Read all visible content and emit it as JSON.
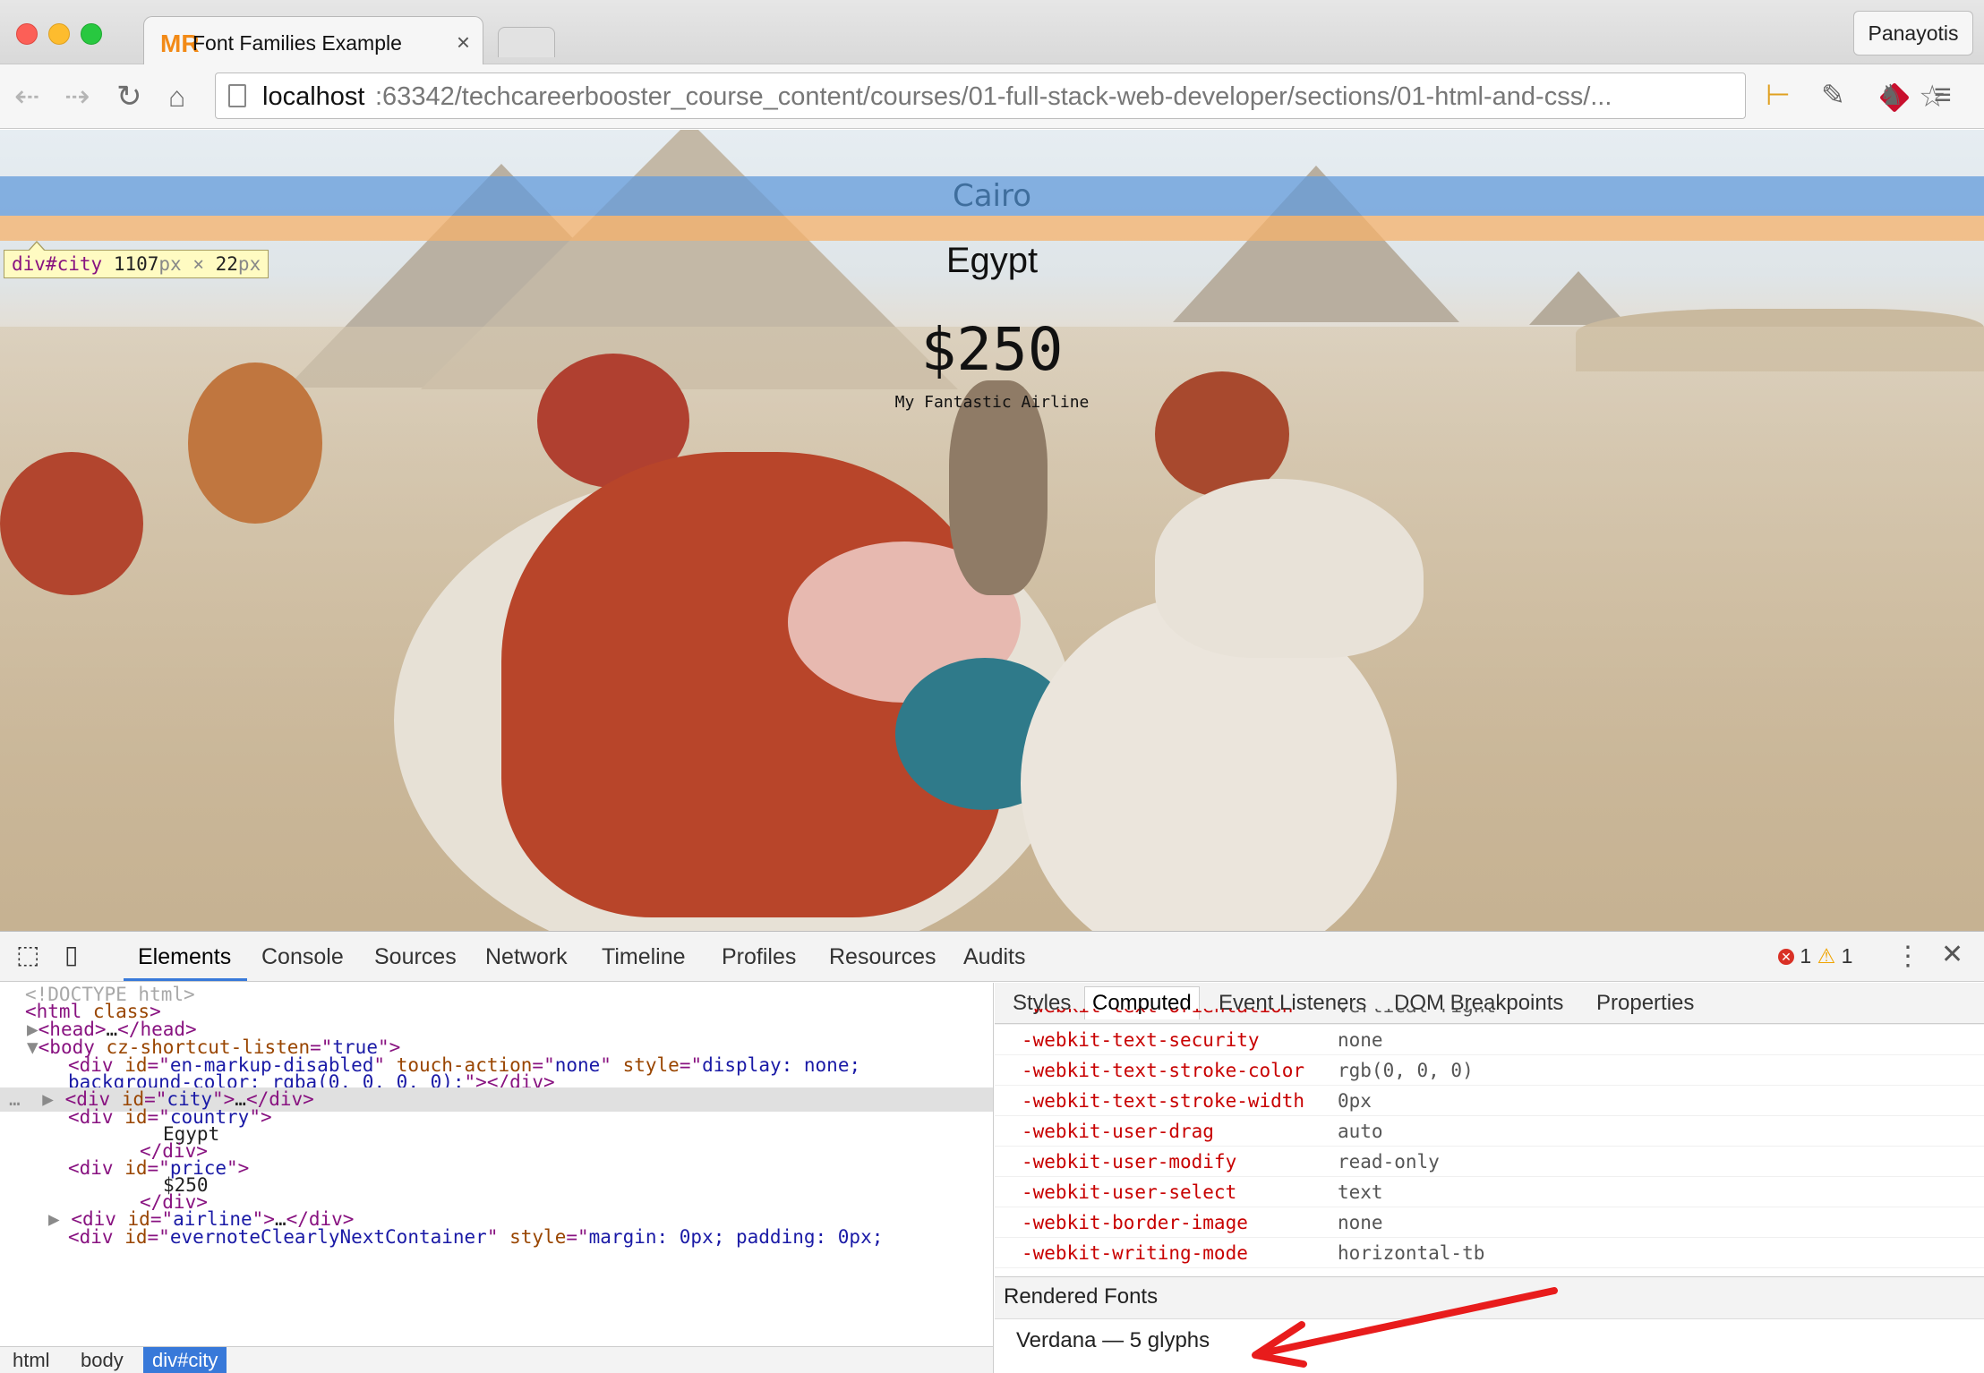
{
  "browser": {
    "tab_favicon": "MR",
    "tab_title": "Font Families Example",
    "tab_close": "×",
    "profile": "Panayotis",
    "url_host": "localhost",
    "url_rest": ":63342/techcareerbooster_course_content/courses/01-full-stack-web-developer/sections/01-html-and-css/...",
    "icons": [
      "back-icon",
      "forward-icon",
      "reload-icon",
      "home-icon",
      "page-icon",
      "ruby-icon",
      "star-icon",
      "extension-icon",
      "eyedropper-icon",
      "evernote-icon",
      "menu-icon"
    ]
  },
  "page": {
    "city": "Cairo",
    "country": "Egypt",
    "price": "$250",
    "airline": "My Fantastic Airline",
    "tooltip": {
      "selector": "div#city",
      "width": "1107",
      "unit": "px",
      "times": " × ",
      "height": "22",
      "unit2": "px"
    },
    "highlight_colors": {
      "content": "#639bdb",
      "margin": "#f6b26b"
    }
  },
  "devtools": {
    "tabs": [
      "Elements",
      "Console",
      "Sources",
      "Network",
      "Timeline",
      "Profiles",
      "Resources",
      "Audits"
    ],
    "errors": "1",
    "warnings": "1",
    "elements_lines": [
      {
        "indent": "",
        "p1": "<!DOCTYPE html>",
        "cls": "p"
      },
      {
        "indent": "",
        "p1": "<html",
        "p2": " class",
        "p3": ">"
      },
      {
        "indent": "",
        "p1": "<head>",
        "p2": "…",
        "p3": "</head>"
      },
      {
        "indent": "",
        "p1": "<body",
        "p2": " cz-shortcut-listen",
        "p3": "=\"",
        "p4": "true",
        "p5": "\">"
      },
      {
        "indent": "",
        "p1": "<div",
        "p2": " id",
        "p3": "=\"",
        "p4": "en-markup-disabled",
        "p5": "\"",
        "p6": " touch-action",
        "p7": "=\"",
        "p8": "none",
        "p9": "\"",
        "p10": " style",
        "p11": "=\"",
        "p12": "display: none;"
      },
      {
        "indent": "",
        "p1": "background-color: rgba(0, 0, 0, 0);",
        "p2": "\">",
        "p3": "</div>"
      },
      {
        "indent": "",
        "p1": "<div",
        "p2": " id",
        "p3": "=\"",
        "p4": "city",
        "p5": "\">",
        "p6": "…",
        "p7": "</div>"
      },
      {
        "indent": "",
        "p1": "<div",
        "p2": " id",
        "p3": "=\"",
        "p4": "country",
        "p5": "\">"
      },
      {
        "indent": "",
        "p1": "Egypt"
      },
      {
        "indent": "",
        "p1": "</div>"
      },
      {
        "indent": "",
        "p1": "<div",
        "p2": " id",
        "p3": "=\"",
        "p4": "price",
        "p5": "\">"
      },
      {
        "indent": "",
        "p1": "$250"
      },
      {
        "indent": "",
        "p1": "</div>"
      },
      {
        "indent": "",
        "p1": "<div",
        "p2": " id",
        "p3": "=\"",
        "p4": "airline",
        "p5": "\">",
        "p6": "…",
        "p7": "</div>"
      },
      {
        "indent": "",
        "p1": "<div",
        "p2": " id",
        "p3": "=\"",
        "p4": "evernoteClearlyNextContainer",
        "p5": "\"",
        "p6": " style",
        "p7": "=\"",
        "p8": "margin: 0px; padding: 0px;"
      }
    ],
    "breadcrumbs": [
      "html",
      "body",
      "div#city"
    ],
    "sidebar_tabs": [
      "Styles",
      "Computed",
      "Event Listeners",
      "DOM Breakpoints",
      "Properties"
    ],
    "computed": [
      {
        "name": "-webkit-text-orientation",
        "value": "vertical-right"
      },
      {
        "name": "-webkit-text-security",
        "value": "none"
      },
      {
        "name": "-webkit-text-stroke-color",
        "value": "rgb(0, 0, 0)"
      },
      {
        "name": "-webkit-text-stroke-width",
        "value": "0px"
      },
      {
        "name": "-webkit-user-drag",
        "value": "auto"
      },
      {
        "name": "-webkit-user-modify",
        "value": "read-only"
      },
      {
        "name": "-webkit-user-select",
        "value": "text"
      },
      {
        "name": "-webkit-border-image",
        "value": "none"
      },
      {
        "name": "-webkit-writing-mode",
        "value": "horizontal-tb"
      }
    ],
    "rendered_fonts_header": "Rendered Fonts",
    "rendered_font": "Verdana — 5 glyphs"
  }
}
